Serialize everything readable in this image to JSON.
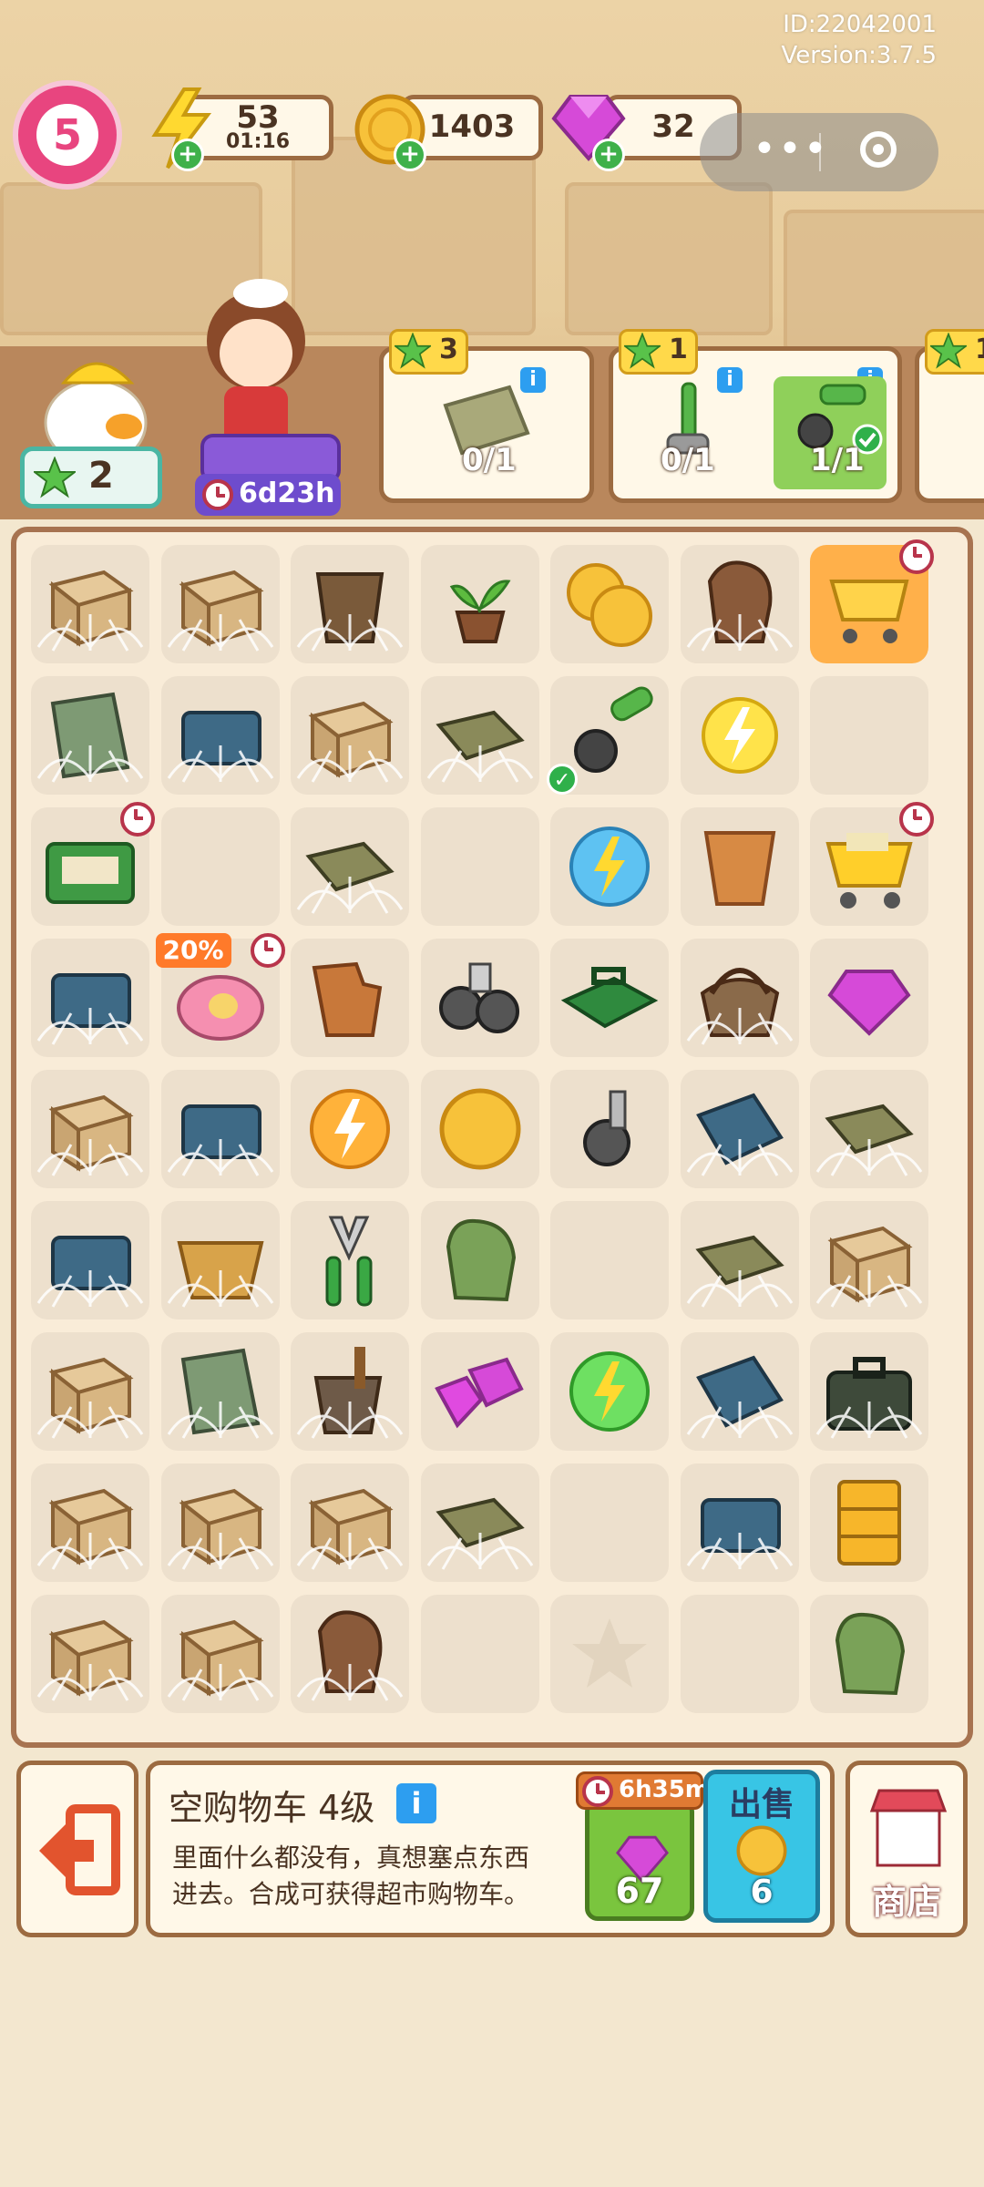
{
  "header": {
    "id_text": "ID:22042001",
    "version_text": "Version:3.7.5"
  },
  "player": {
    "level": "5"
  },
  "resources": {
    "energy": {
      "value": "53",
      "timer": "01:16"
    },
    "coins": {
      "value": "1403"
    },
    "gems": {
      "value": "32"
    }
  },
  "stars": {
    "value": "2"
  },
  "event": {
    "timer": "6d23h"
  },
  "orders": [
    {
      "stars": "3",
      "progress": "0/1"
    },
    {
      "stars": "1",
      "bonus": "1",
      "progress_a": "0/1",
      "progress_b": "1/1"
    },
    {
      "stars": "1"
    }
  ],
  "board": {
    "discount_label": "20%",
    "rows": [
      [
        "box",
        "box",
        "bucket",
        "sprout",
        "coins",
        "glove-brown",
        "cart-empty"
      ],
      [
        "newspaper",
        "chip",
        "box",
        "tray",
        "handle",
        "energy-yellow",
        "empty"
      ],
      [
        "toolbox",
        "empty",
        "tray",
        "empty",
        "energy-blue",
        "bucket-clay",
        "cart-full"
      ],
      [
        "chip",
        "piggy-bag",
        "broken-pot",
        "wheels",
        "green-case",
        "basket-web",
        "gem"
      ],
      [
        "box",
        "chip",
        "energy-orange",
        "coin",
        "wheel",
        "chip-board",
        "tray"
      ],
      [
        "chip",
        "basket",
        "pliers",
        "glove-green",
        "empty",
        "tray",
        "box"
      ],
      [
        "box",
        "newspaper",
        "bucket-shovel",
        "gems",
        "energy-green",
        "chip-board",
        "briefcase"
      ],
      [
        "box",
        "box",
        "box",
        "tray",
        "empty",
        "chip",
        "drawers"
      ],
      [
        "box",
        "box",
        "glove-brown",
        "empty",
        "star-slot",
        "empty",
        "glove-green"
      ]
    ]
  },
  "selected": {
    "title": "空购物车 4级",
    "description": "里面什么都没有，真想塞点东西进去。合成可获得超市购物车。",
    "buy_timer": "6h35m",
    "buy_price": "67",
    "sell_label": "出售",
    "sell_price": "6"
  },
  "shop": {
    "label": "商店"
  },
  "colors": {
    "frame": "#9c6b41",
    "board_bg": "#f9ecd8",
    "cell_bg": "#ede0cd",
    "buy": "#7ac53e",
    "sell": "#38c5e5"
  }
}
